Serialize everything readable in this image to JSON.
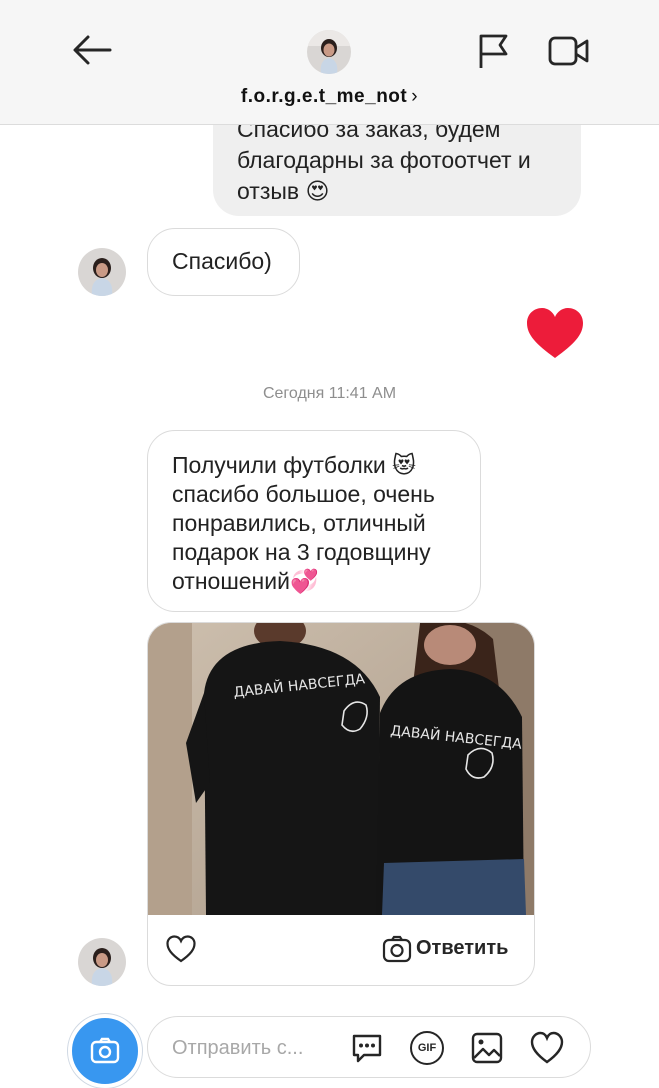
{
  "header": {
    "username": "f.o.r.g.e.t_me_not",
    "chevron": "›",
    "icons": [
      "back-arrow-icon",
      "avatar",
      "flag-icon",
      "video-camera-icon"
    ]
  },
  "messages": {
    "sent_1_lines": [
      "Спасибо за заказ, будем",
      "благодарны за фотоотчет и",
      "отзыв"
    ],
    "sent_1_emoji": "😍",
    "received_1": "Спасибо)",
    "timestamp": "Сегодня 11:41 AM",
    "received_2_lines": [
      "Получили футболки 😻",
      "спасибо большое, очень",
      "понравились, отличный",
      "подарок на 3 годовщину",
      "отношений💞"
    ]
  },
  "post": {
    "shirt_text": "ДАВАЙ НАВСЕГДА",
    "reply_label": "Ответить"
  },
  "composer": {
    "placeholder": "Отправить с...",
    "gif_label": "GIF"
  },
  "colors": {
    "accent": "#3897f0",
    "heart": "#ed1c3a",
    "received_border": "#dbdbdb",
    "sent_bg": "#efefef"
  }
}
